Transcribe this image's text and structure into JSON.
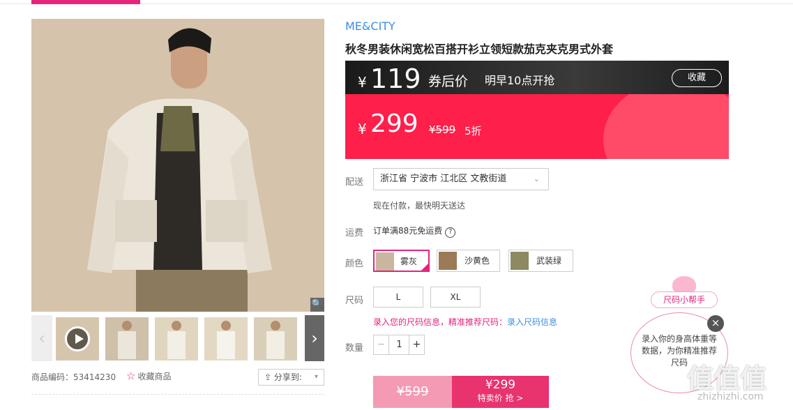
{
  "brand": "ME&CITY",
  "title": "秋冬男装休闲宽松百搭开衫立领短款茄克夹克男式外套",
  "coupon": {
    "currency": "¥",
    "price": "119",
    "label": "券后价",
    "time": "明早10点开抢",
    "collect": "收藏"
  },
  "sale": {
    "currency": "¥",
    "price": "299",
    "original": "¥599",
    "discount": "5折"
  },
  "delivery": {
    "label": "配送",
    "address": "浙江省 宁波市 江北区 文教街道",
    "note": "现在付款，最快明天送达"
  },
  "shipping": {
    "label": "运费",
    "text": "订单满88元免运费",
    "help": "?"
  },
  "colors": {
    "label": "颜色",
    "options": [
      "雾灰",
      "沙黄色",
      "武装绿"
    ]
  },
  "sizes": {
    "label": "尺码",
    "options": [
      "L",
      "XL"
    ],
    "info_pink": "录入您的尺码信息，精准推荐尺码：",
    "info_link": "录入尺码信息"
  },
  "quantity": {
    "label": "数量",
    "value": "1",
    "minus": "−",
    "plus": "+"
  },
  "buy": {
    "original": "¥599",
    "price": "¥299",
    "action": "特卖价 抢 >"
  },
  "product": {
    "code": "商品编码：53414230",
    "favorite": "收藏商品",
    "share": "分享到:"
  },
  "helper": {
    "title": "尺码小帮手",
    "text": "录入你的身高体重等数据，为你精准推荐尺码",
    "close": "×"
  },
  "watermark": {
    "logo": "值值值",
    "domain": "zhizhizhi.com"
  },
  "colors_theme": {
    "accent": "#e8237c",
    "link": "#3b8ee8",
    "sale_red": "#ff1f4b"
  }
}
